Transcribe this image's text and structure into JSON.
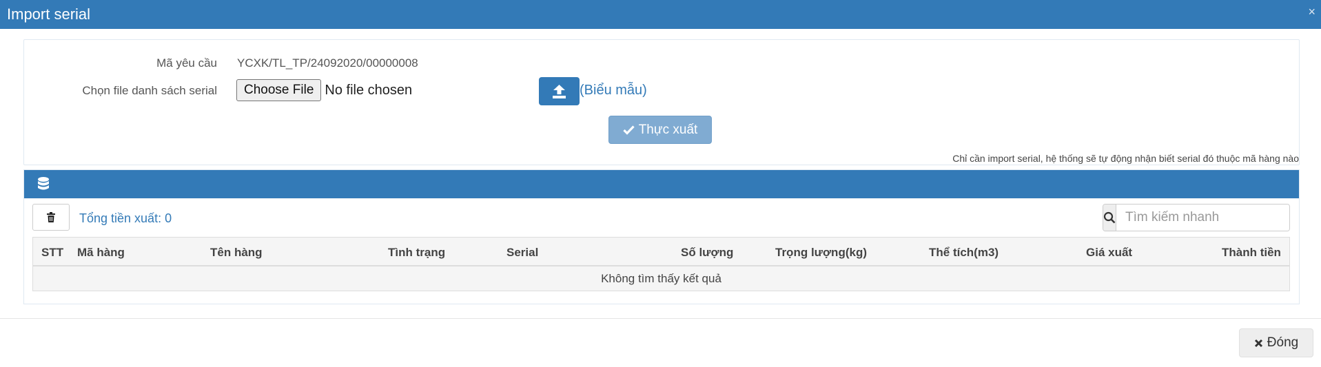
{
  "dialog": {
    "title": "Import serial",
    "close_icon": "×"
  },
  "form": {
    "request_code_label": "Mã yêu cầu",
    "request_code_value": "YCXK/TL_TP/24092020/00000008",
    "file_label": "Chọn file danh sách serial",
    "choose_file_label": "Choose File",
    "no_file_text": "No file chosen",
    "template_link": "(Biểu mẫu)",
    "submit_label": "Thực xuất",
    "note": "Chỉ cần import serial, hệ thống sẽ tự động nhận biết serial đó thuộc mã hàng nào"
  },
  "list": {
    "total_label": "Tổng tiền xuất: 0",
    "search_placeholder": "Tìm kiếm nhanh",
    "columns": [
      "STT",
      "Mã hàng",
      "Tên hàng",
      "Tình trạng",
      "Serial",
      "Số lượng",
      "Trọng lượng(kg)",
      "Thể tích(m3)",
      "Giá xuất",
      "Thành tiền"
    ],
    "empty_text": "Không tìm thấy kết quả"
  },
  "footer": {
    "close_label": "Đóng"
  },
  "colors": {
    "primary": "#337ab7",
    "submit_disabled": "#80abd2",
    "link": "#337ab7"
  },
  "icons": {
    "upload": "upload-icon",
    "database": "database-icon",
    "trash": "trash-icon",
    "search": "search-icon",
    "check": "check-icon",
    "close": "close-icon"
  }
}
